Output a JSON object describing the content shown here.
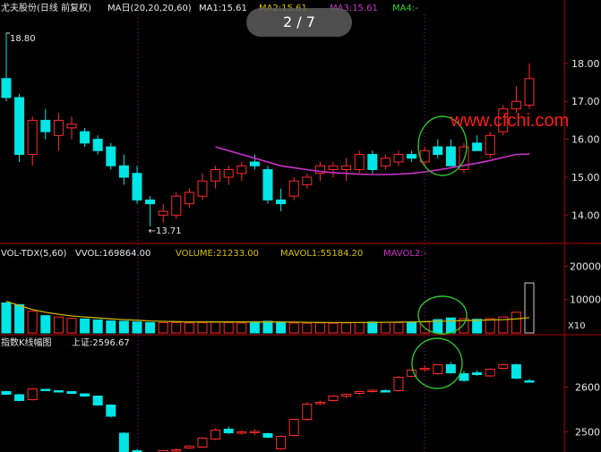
{
  "overlay": {
    "pager": "2 / 7",
    "watermark": "www.cfchi.com"
  },
  "price_panel": {
    "header": {
      "name": "尤夫股份(日线 前复权)",
      "ma_title": "MA日(20,20,20,60)",
      "ma1": "MA1:15.61",
      "ma2": "MA2:15.61",
      "ma3": "MA3:15.61",
      "ma4": "MA4:-"
    },
    "high_label": "18.80",
    "low_label": "←13.71",
    "y_ticks": [
      "18.00",
      "17.00",
      "16.00",
      "15.00",
      "14.00"
    ]
  },
  "volume_panel": {
    "header": {
      "title": "VOL-TDX(5,60)",
      "vvol": "VVOL:169864.00",
      "volume": "VOLUME:21233.00",
      "mavol1": "MAVOL1:55184.20",
      "mavol2": "MAVOL2:-"
    },
    "y_ticks": [
      "20000",
      "10000"
    ],
    "unit": "X10"
  },
  "index_panel": {
    "header": {
      "title": "指数K线幅图",
      "value": "上证:2596.67"
    },
    "y_ticks": [
      "2600",
      "2500"
    ]
  },
  "colors": {
    "up": "#ff2b2b",
    "down": "#00e5e5",
    "ma": "#c832c8",
    "mavol": "#c8b400",
    "circle": "#2fbf2f",
    "axis": "#b00000",
    "text": "#e8e8e8"
  },
  "chart_data": [
    {
      "type": "candlestick",
      "title": "尤夫股份(日线 前复权)",
      "ylim": [
        13.3,
        19.2
      ],
      "annotations": [
        "18.80",
        "13.71"
      ],
      "ohlc": [
        [
          17.6,
          18.8,
          17.0,
          17.1
        ],
        [
          17.1,
          17.2,
          15.4,
          15.6
        ],
        [
          15.6,
          16.6,
          15.3,
          16.5
        ],
        [
          16.5,
          16.8,
          16.0,
          16.2
        ],
        [
          16.1,
          16.7,
          15.7,
          16.5
        ],
        [
          16.3,
          16.6,
          16.0,
          16.4
        ],
        [
          16.2,
          16.3,
          15.8,
          15.9
        ],
        [
          16.0,
          16.1,
          15.6,
          15.7
        ],
        [
          15.8,
          15.9,
          15.2,
          15.3
        ],
        [
          15.3,
          15.6,
          14.8,
          15.0
        ],
        [
          15.1,
          15.3,
          14.3,
          14.4
        ],
        [
          14.4,
          14.5,
          13.7,
          14.3
        ],
        [
          14.0,
          14.3,
          13.8,
          14.1
        ],
        [
          14.0,
          14.6,
          13.9,
          14.5
        ],
        [
          14.3,
          14.7,
          14.2,
          14.6
        ],
        [
          14.5,
          15.1,
          14.4,
          14.9
        ],
        [
          14.9,
          15.3,
          14.7,
          15.2
        ],
        [
          15.0,
          15.3,
          14.8,
          15.2
        ],
        [
          15.1,
          15.4,
          14.9,
          15.3
        ],
        [
          15.4,
          15.6,
          15.2,
          15.3
        ],
        [
          15.2,
          15.3,
          14.3,
          14.4
        ],
        [
          14.4,
          14.7,
          14.1,
          14.3
        ],
        [
          14.5,
          15.0,
          14.4,
          14.9
        ],
        [
          14.8,
          15.1,
          14.7,
          15.0
        ],
        [
          15.1,
          15.4,
          14.9,
          15.3
        ],
        [
          15.2,
          15.4,
          15.0,
          15.3
        ],
        [
          15.2,
          15.5,
          14.9,
          15.3
        ],
        [
          15.2,
          15.7,
          15.1,
          15.6
        ],
        [
          15.6,
          15.7,
          15.1,
          15.2
        ],
        [
          15.3,
          15.6,
          15.2,
          15.5
        ],
        [
          15.4,
          15.7,
          15.3,
          15.6
        ],
        [
          15.6,
          15.7,
          15.4,
          15.5
        ],
        [
          15.4,
          15.8,
          15.3,
          15.7
        ],
        [
          15.8,
          16.0,
          15.5,
          15.6
        ],
        [
          15.8,
          16.0,
          15.3,
          15.3
        ],
        [
          15.2,
          15.9,
          15.1,
          15.8
        ],
        [
          15.9,
          16.1,
          15.7,
          15.7
        ],
        [
          15.6,
          16.2,
          15.5,
          16.1
        ],
        [
          16.2,
          16.9,
          16.1,
          16.8
        ],
        [
          16.8,
          17.4,
          16.7,
          17.0
        ],
        [
          16.9,
          18.0,
          16.8,
          17.6
        ]
      ],
      "ma": [
        null,
        null,
        null,
        null,
        null,
        null,
        null,
        null,
        null,
        null,
        null,
        null,
        null,
        null,
        null,
        null,
        15.8,
        15.7,
        15.6,
        15.5,
        15.4,
        15.3,
        15.25,
        15.2,
        15.15,
        15.12,
        15.1,
        15.08,
        15.07,
        15.07,
        15.08,
        15.1,
        15.14,
        15.19,
        15.25,
        15.31,
        15.37,
        15.44,
        15.52,
        15.6,
        15.61
      ]
    },
    {
      "type": "bar",
      "title": "VOL-TDX(5,60)",
      "ylim": [
        0,
        22000
      ],
      "values": [
        9000,
        8500,
        6500,
        5200,
        4800,
        4400,
        4200,
        3900,
        3600,
        3500,
        3300,
        3100,
        3100,
        3100,
        3000,
        3100,
        3200,
        3100,
        3000,
        3400,
        3500,
        3200,
        3000,
        2900,
        3000,
        2900,
        3000,
        3100,
        3300,
        3200,
        3100,
        3200,
        3300,
        4000,
        4500,
        4300,
        4100,
        4300,
        4800,
        6200,
        15000
      ],
      "mavol1": [
        9500,
        8200,
        7000,
        6200,
        5600,
        5100,
        4800,
        4500,
        4200,
        4000,
        3800,
        3600,
        3500,
        3400,
        3300,
        3300,
        3300,
        3300,
        3300,
        3300,
        3300,
        3300,
        3250,
        3200,
        3150,
        3100,
        3100,
        3100,
        3150,
        3200,
        3250,
        3300,
        3400,
        3500,
        3600,
        3700,
        3800,
        3900,
        4000,
        4200,
        4600
      ]
    },
    {
      "type": "candlestick",
      "title": "指数K线幅图",
      "ylim": [
        2455,
        2685
      ],
      "ohlc": [
        [
          2590,
          2592,
          2582,
          2584
        ],
        [
          2583,
          2585,
          2568,
          2570
        ],
        [
          2572,
          2598,
          2570,
          2596
        ],
        [
          2595,
          2596,
          2591,
          2593
        ],
        [
          2592,
          2593,
          2588,
          2591
        ],
        [
          2590,
          2591,
          2585,
          2586
        ],
        [
          2585,
          2586,
          2578,
          2580
        ],
        [
          2580,
          2581,
          2558,
          2560
        ],
        [
          2560,
          2561,
          2532,
          2535
        ],
        [
          2497,
          2499,
          2451,
          2452
        ],
        [
          2458,
          2462,
          2446,
          2448
        ],
        [
          2446,
          2452,
          2438,
          2450
        ],
        [
          2452,
          2460,
          2450,
          2458
        ],
        [
          2457,
          2463,
          2455,
          2460
        ],
        [
          2464,
          2470,
          2462,
          2468
        ],
        [
          2466,
          2488,
          2464,
          2486
        ],
        [
          2484,
          2508,
          2482,
          2504
        ],
        [
          2506,
          2512,
          2495,
          2498
        ],
        [
          2497,
          2503,
          2494,
          2500
        ],
        [
          2499,
          2506,
          2493,
          2501
        ],
        [
          2496,
          2498,
          2486,
          2488
        ],
        [
          2462,
          2492,
          2460,
          2490
        ],
        [
          2492,
          2530,
          2490,
          2528
        ],
        [
          2528,
          2566,
          2525,
          2562
        ],
        [
          2566,
          2570,
          2560,
          2566
        ],
        [
          2570,
          2582,
          2568,
          2580
        ],
        [
          2580,
          2586,
          2575,
          2584
        ],
        [
          2586,
          2592,
          2582,
          2590
        ],
        [
          2591,
          2595,
          2588,
          2593
        ],
        [
          2592,
          2595,
          2588,
          2590
        ],
        [
          2592,
          2625,
          2590,
          2622
        ],
        [
          2624,
          2640,
          2622,
          2638
        ],
        [
          2640,
          2648,
          2635,
          2642
        ],
        [
          2630,
          2651,
          2628,
          2650
        ],
        [
          2650,
          2656,
          2630,
          2632
        ],
        [
          2630,
          2636,
          2612,
          2615
        ],
        [
          2632,
          2638,
          2625,
          2628
        ],
        [
          2625,
          2642,
          2623,
          2640
        ],
        [
          2642,
          2652,
          2640,
          2650
        ],
        [
          2650,
          2652,
          2618,
          2620
        ],
        [
          2614,
          2618,
          2610,
          2612
        ]
      ]
    }
  ]
}
